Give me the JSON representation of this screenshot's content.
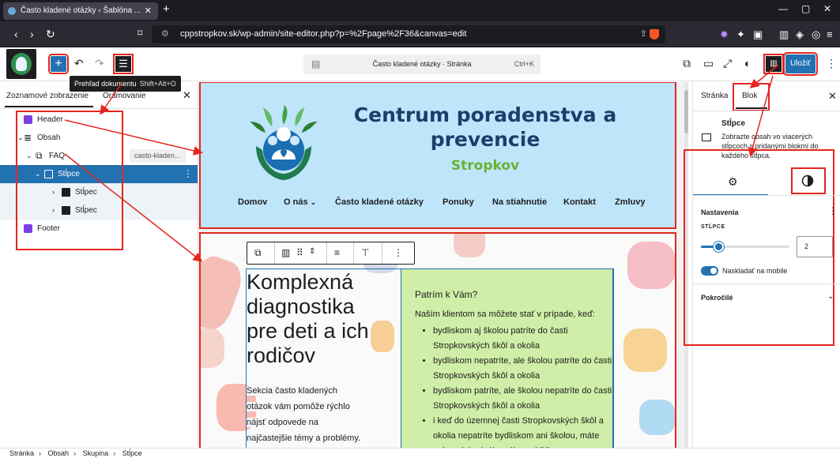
{
  "browser": {
    "tab_title": "Často kladené otázky ‹ Šablóna ...",
    "url": "cppstropkov.sk/wp-admin/site-editor.php?p=%2Fpage%2F36&canvas=edit"
  },
  "editor_toolbar": {
    "tooltip_label": "Prehľad dokumentu",
    "tooltip_shortcut": "Shift+Alt+O",
    "command_center_label": "Často kladené otázky · Stránka",
    "command_center_shortcut": "Ctrl+K",
    "save_label": "Uložiť"
  },
  "left_panel": {
    "tab_list_view": "Zoznamové zobrazenie",
    "tab_outline": "Orámovanie",
    "tree": [
      {
        "label": "Header",
        "icon": "template-part-icon"
      },
      {
        "label": "Obsah",
        "icon": "post-content-icon"
      },
      {
        "label": "FAQ",
        "icon": "group-icon",
        "badge": "casto-kladen..."
      },
      {
        "label": "Stĺpce",
        "icon": "columns-icon"
      },
      {
        "label": "Stĺpec",
        "icon": "column-icon"
      },
      {
        "label": "Stĺpec",
        "icon": "column-icon"
      },
      {
        "label": "Footer",
        "icon": "template-part-icon"
      }
    ]
  },
  "site_header": {
    "title": "Centrum poradenstva a prevencie",
    "subtitle": "Stropkov",
    "nav": [
      "Domov",
      "O nás",
      "Často kladené otázky",
      "Ponuky",
      "Na stiahnutie",
      "Kontakt",
      "Zmluvy"
    ]
  },
  "content": {
    "heading": "Komplexná diagnostika pre deti a ich rodičov",
    "lead_text": "Sekcia často kladených otázok vám pomôže rýchlo nájsť odpovede na najčastejšie témy a problémy.",
    "col2_title": "Patrím k Vám?",
    "col2_intro": "Naším klientom sa môžete stať v prípade, keď:",
    "bullets": [
      "bydliskom aj školou patríte do časti Stropkovských škôl a okolia",
      "bydliskom nepatríte, ale školou patríte do časti Stropkovských škôl a okolia",
      "bydliskom patríte, ale školou nepatríte do časti Stropkovských škôl a okolia",
      "i keď do územnej časti Stropkovských škôl a okolia nepatríte bydliskom ani školou, máte právo slobodného výberu CPP"
    ]
  },
  "right_panel": {
    "tab_page": "Stránka",
    "tab_block": "Blok",
    "block_name": "Stĺpce",
    "block_description": "Zobrazte obsah vo viacerých stĺpcoch s pridanými blokmi do každého stĺpca.",
    "settings_heading": "Nastavenia",
    "columns_label": "STĹPCE",
    "columns_value": "2",
    "columns_slider_fraction": 0.2,
    "stack_on_mobile_label": "Naskladať na mobile",
    "stack_on_mobile": true,
    "advanced_label": "Pokročilé"
  },
  "breadcrumb": [
    "Stránka",
    "Obsah",
    "Skupina",
    "Stĺpce"
  ],
  "colors": {
    "accent": "#2271b1",
    "annotation_red": "#e3261f",
    "header_bg": "#bfe5fa",
    "title_blue": "#1a3f6d",
    "subtitle_green": "#6ab232",
    "column_green": "#cfeea7"
  }
}
